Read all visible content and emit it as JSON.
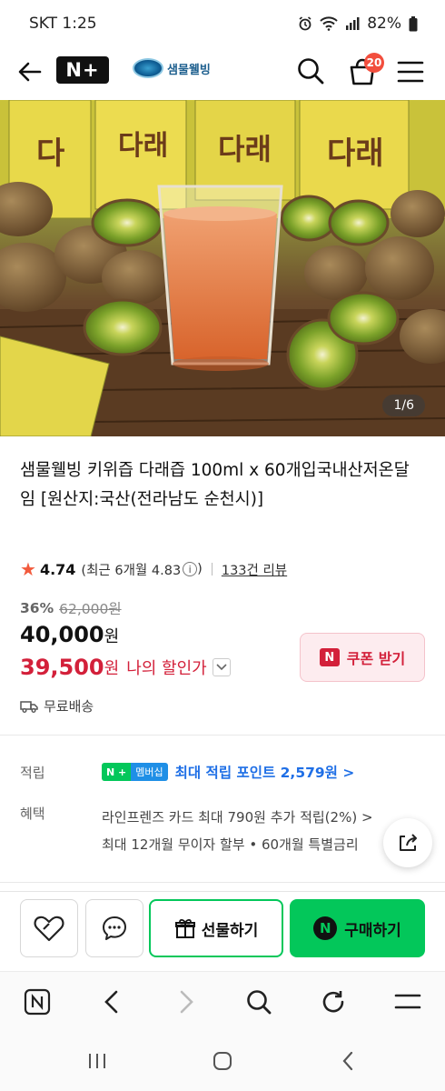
{
  "status_bar": {
    "carrier_time": "SKT 1:25",
    "battery": "82%"
  },
  "header": {
    "logo_text": "N+",
    "brand_name": "샘물웰빙",
    "cart_count": "20"
  },
  "product": {
    "image_counter": "1/6",
    "title": "샘물웰빙 키위즙 다래즙 100ml x 60개입국내산저온달임 [원산지:국산(전라남도 순천시)]",
    "rating": "4.74",
    "rating_recent": "(최근 6개월 4.83",
    "rating_recent_close": ")",
    "review_count": "133건 리뷰",
    "discount_rate": "36%",
    "original_price": "62,000원",
    "sale_price": "40,000",
    "my_price": "39,500",
    "currency": "원",
    "my_price_label": "나의 할인가",
    "coupon_label": "쿠폰 받기",
    "shipping": "무료배송"
  },
  "points": {
    "label": "적립",
    "badge_n": "N +",
    "badge_membership": "멤버십",
    "text": "최대 적립 포인트 2,579원 >"
  },
  "benefit": {
    "label": "혜택",
    "line1": "라인프렌즈 카드 최대 790원 추가 적립(2%) >",
    "line2": "최대 12개월 무이자 할부 • 60개월 특별금리"
  },
  "actions": {
    "gift_label": "선물하기",
    "buy_label": "구매하기"
  },
  "colors": {
    "naver_green": "#03c75a",
    "price_red": "#d3203a",
    "points_blue": "#1f6fe6"
  }
}
